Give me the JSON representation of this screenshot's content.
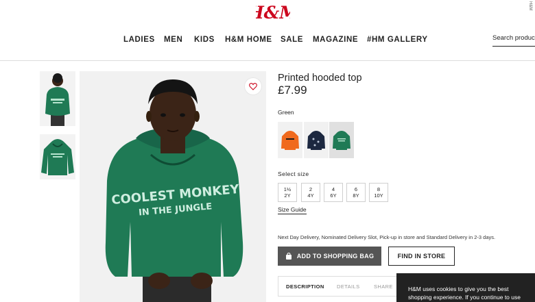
{
  "brand": {
    "logo": "H&M",
    "color": "#cc071e"
  },
  "watermark": "H&M",
  "nav": {
    "items": [
      {
        "label": "LADIES"
      },
      {
        "label": "MEN"
      },
      {
        "label": "KIDS"
      },
      {
        "label": "H&M HOME"
      },
      {
        "label": "SALE"
      },
      {
        "label": "MAGAZINE"
      },
      {
        "label": "#HM GALLERY"
      }
    ],
    "search_placeholder": "Search products"
  },
  "gallery": {
    "thumbnails": [
      "model-wearing-hoodie",
      "hoodie-flat"
    ],
    "print_line1": "COOLEST MONKEY",
    "print_line2": "IN THE JUNGLE",
    "favorite_icon": "heart-icon"
  },
  "product": {
    "title": "Printed hooded top",
    "price": "£7.99",
    "color_label": "Green",
    "colors": [
      {
        "name": "Orange",
        "hex": "#f06a1e"
      },
      {
        "name": "Dark blue",
        "hex": "#1c2840"
      },
      {
        "name": "Green",
        "hex": "#1f7a55",
        "selected": true
      }
    ],
    "size_label": "Select size",
    "sizes": [
      {
        "line1": "1½",
        "line2": "2Y"
      },
      {
        "line1": "2",
        "line2": "4Y"
      },
      {
        "line1": "4",
        "line2": "6Y"
      },
      {
        "line1": "6",
        "line2": "8Y"
      },
      {
        "line1": "8",
        "line2": "10Y"
      }
    ],
    "size_guide": "Size Guide",
    "delivery": "Next Day Delivery, Nominated Delivery Slot, Pick-up in store and Standard Delivery in 2-3 days.",
    "add_to_bag": "ADD TO SHOPPING BAG",
    "find_in_store": "FIND IN STORE",
    "tabs": [
      {
        "label": "DESCRIPTION",
        "active": true
      },
      {
        "label": "DETAILS"
      },
      {
        "label": "SHARE"
      }
    ]
  },
  "cookie": {
    "line1": "H&M uses cookies to give you the best",
    "line2": "shopping experience. If you continue to use"
  }
}
